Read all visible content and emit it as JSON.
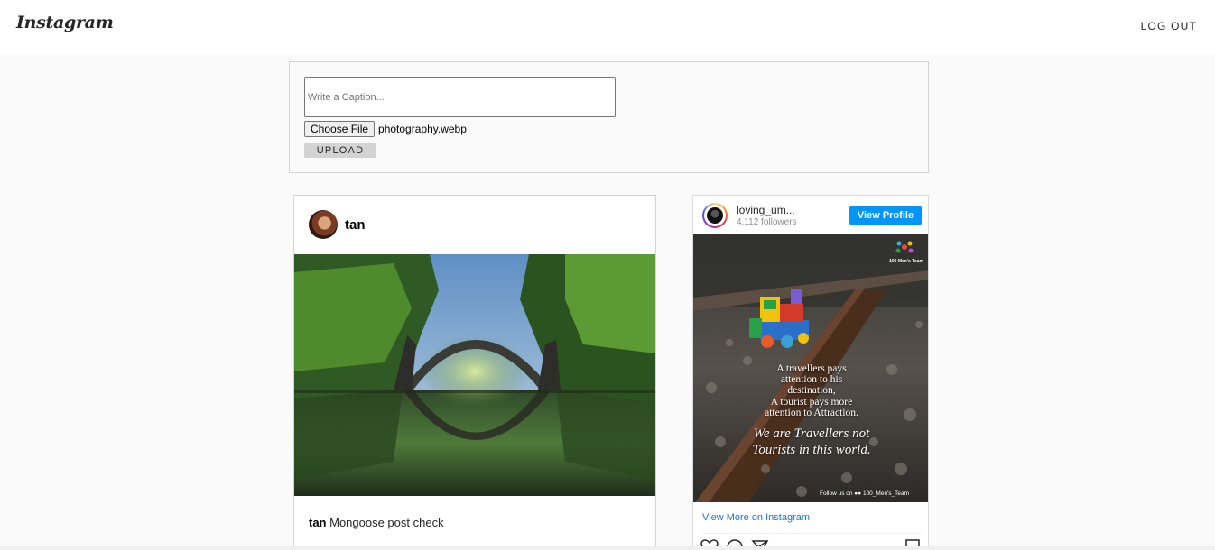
{
  "header": {
    "logo": "Instagram",
    "logout_label": "LOG OUT"
  },
  "upload": {
    "caption_placeholder": "Write a Caption...",
    "choose_file_label": "Choose File",
    "file_name": "photography.webp",
    "upload_label": "UPLOAD"
  },
  "post": {
    "author": "tan",
    "caption_user": "tan",
    "caption_text": " Mongoose post check"
  },
  "embed": {
    "username": "loving_um...",
    "followers": "4,112 followers",
    "view_profile_label": "View Profile",
    "image_quote_lines": [
      "A travellers pays",
      "attention to his",
      "destination,",
      "A tourist pays more",
      "attention to Attraction."
    ],
    "image_quote_tagline_lines": [
      "We are Travellers not",
      "Tourists in this world."
    ],
    "image_brand": "100 Men's Team",
    "image_follow": "Follow us on ●● 100_Men's_Team",
    "view_more_label": "View More on Instagram",
    "button_color": "#0095f6"
  },
  "icons": [
    "heart-icon",
    "comment-icon",
    "share-icon",
    "bookmark-icon"
  ]
}
